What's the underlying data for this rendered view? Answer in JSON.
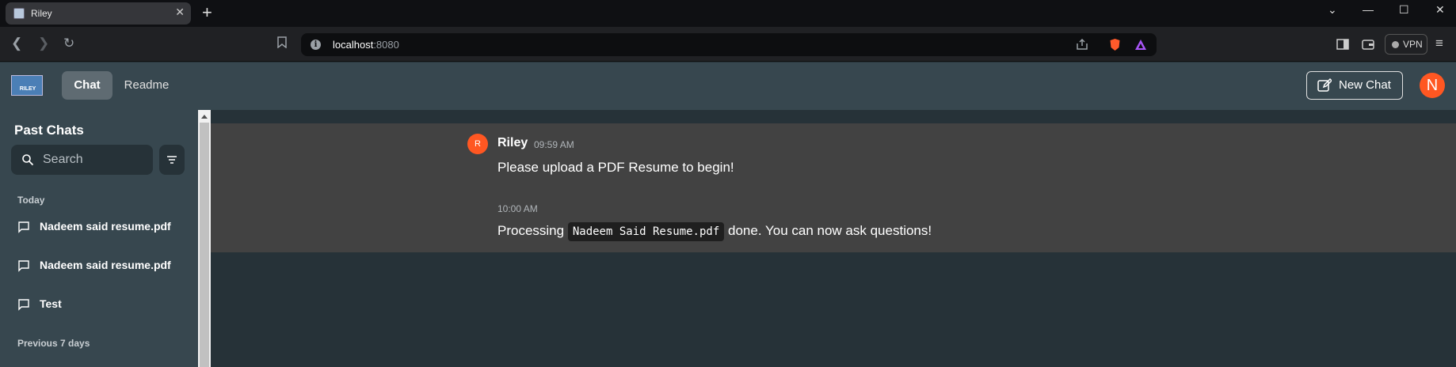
{
  "browser": {
    "tab_title": "Riley",
    "tab_close": "✕",
    "new_tab": "+",
    "url_host": "localhost",
    "url_port": ":8080",
    "vpn_label": "VPN"
  },
  "header": {
    "logo_text": "RILEY",
    "tabs": [
      {
        "label": "Chat",
        "active": true
      },
      {
        "label": "Readme",
        "active": false
      }
    ],
    "new_chat_label": "New Chat",
    "user_initial": "N",
    "accent_color": "#ff5722"
  },
  "sidebar": {
    "title": "Past Chats",
    "search_placeholder": "Search",
    "sections": [
      {
        "label": "Today",
        "items": [
          "Nadeem said resume.pdf",
          "Nadeem said resume.pdf",
          "Test"
        ]
      },
      {
        "label": "Previous 7 days",
        "items": []
      }
    ]
  },
  "messages": {
    "author": "Riley",
    "avatar_initial": "R",
    "entries": [
      {
        "time": "09:59 AM",
        "text": "Please upload a PDF Resume to begin!"
      },
      {
        "time": "10:00 AM",
        "prefix": "Processing",
        "code": "Nadeem Said Resume.pdf",
        "suffix": "done. You can now ask questions!"
      }
    ]
  }
}
